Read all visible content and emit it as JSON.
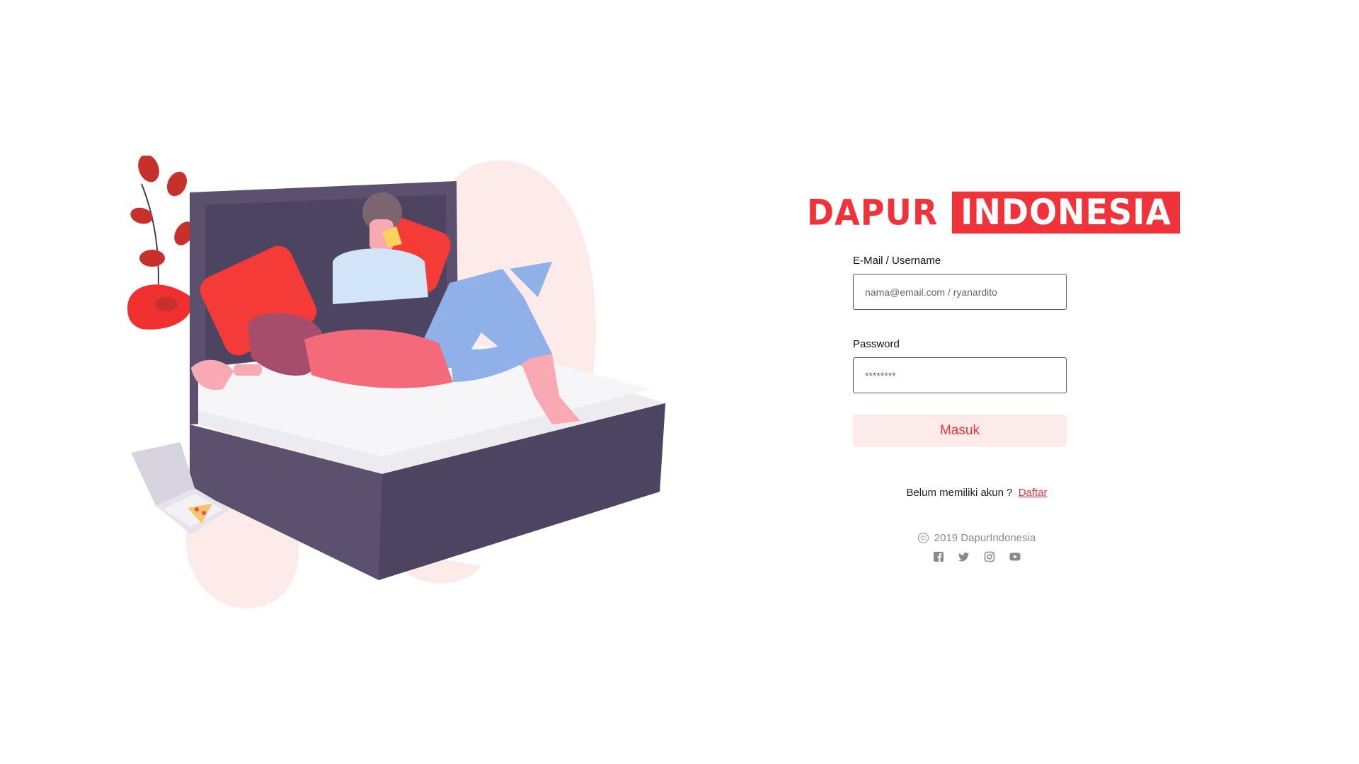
{
  "brand": {
    "part1": "DAPUR",
    "part2": "INDONESIA"
  },
  "form": {
    "email_label": "E-Mail / Username",
    "email_placeholder": "nama@email.com / ryanardito",
    "password_label": "Password",
    "password_placeholder": "********",
    "submit_label": "Masuk"
  },
  "register": {
    "text": "Belum memiliki akun ?",
    "link_label": "Daftar"
  },
  "footer": {
    "copyright_symbol": "©",
    "copyright_text": "2019 DapurIndonesia",
    "social_icons": [
      "facebook-icon",
      "twitter-icon",
      "instagram-icon",
      "youtube-icon"
    ]
  },
  "colors": {
    "accent": "#f0333a",
    "button_bg": "#fdebea",
    "blob": "#fdebea",
    "bed_frame": "#5b506d",
    "pillow": "#f53b37"
  }
}
